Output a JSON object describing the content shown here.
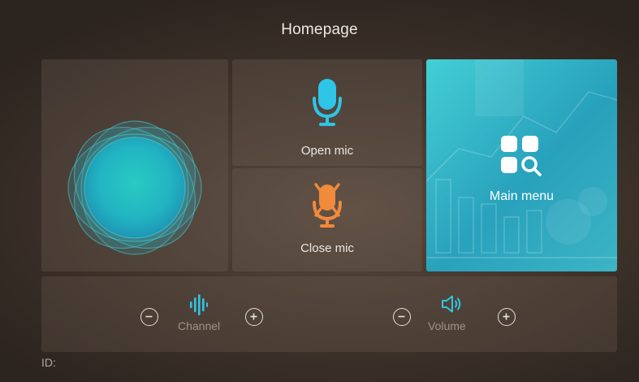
{
  "header": {
    "title": "Homepage"
  },
  "tiles": {
    "open_mic": {
      "label": "Open mic",
      "icon": "microphone-icon"
    },
    "close_mic": {
      "label": "Close mic",
      "icon": "microphone-muted-icon"
    },
    "main_menu": {
      "label": "Main menu",
      "icon": "apps-search-icon"
    }
  },
  "controls": {
    "channel": {
      "label": "Channel",
      "icon": "sound-wave-icon",
      "decrease_icon": "minus-circle-icon",
      "increase_icon": "plus-circle-icon"
    },
    "volume": {
      "label": "Volume",
      "icon": "speaker-icon",
      "decrease_icon": "minus-circle-icon",
      "increase_icon": "plus-circle-icon"
    }
  },
  "footer": {
    "id_label": "ID:"
  },
  "colors": {
    "accent_cyan": "#2ec5e6",
    "accent_orange": "#f08a3c",
    "menu_tile": "#3cc6d8",
    "text": "#ebe7e2",
    "muted_text": "#9c938a"
  }
}
